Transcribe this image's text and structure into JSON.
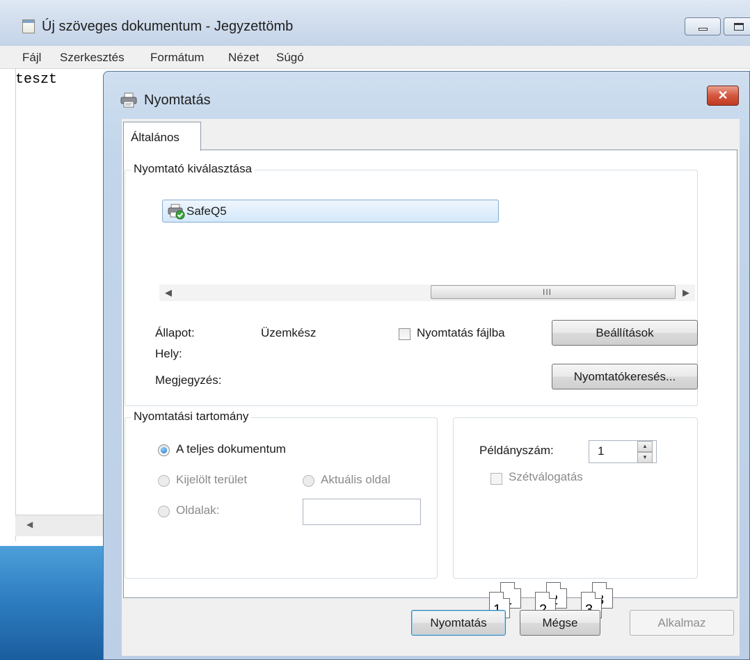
{
  "notepad": {
    "title": "Új szöveges dokumentum - Jegyzettömb",
    "menu": [
      "Fájl",
      "Szerkesztés",
      "Formátum",
      "Nézet",
      "Súgó"
    ],
    "content": "teszt"
  },
  "dialog": {
    "title": "Nyomtatás",
    "close_label": "✕",
    "tab": "Általános",
    "printer_group": {
      "label": "Nyomtató kiválasztása",
      "printers": [
        "SafeQ5"
      ],
      "scroll_thumb": "III",
      "status_label": "Állapot:",
      "status_value": "Üzemkész",
      "location_label": "Hely:",
      "comment_label": "Megjegyzés:",
      "print_to_file_label": "Nyomtatás fájlba",
      "print_to_file_checked": false,
      "preferences_button": "Beállítások",
      "find_printer_button": "Nyomtatókeresés..."
    },
    "range_group": {
      "label": "Nyomtatási tartomány",
      "all_label": "A teljes dokumentum",
      "selection_label": "Kijelölt terület",
      "current_page_label": "Aktuális oldal",
      "pages_label": "Oldalak:",
      "pages_value": "",
      "selected": "all"
    },
    "copies_group": {
      "copies_label": "Példányszám:",
      "copies_value": "1",
      "collate_label": "Szétválogatás",
      "collate_checked": false,
      "collate_pages": [
        "1",
        "1",
        "2",
        "2",
        "3",
        "3"
      ]
    },
    "buttons": {
      "print": "Nyomtatás",
      "cancel": "Mégse",
      "apply": "Alkalmaz"
    }
  },
  "colors": {
    "title_bar": "#cfdcec",
    "close_button": "#c94b32",
    "selection": "#d4e8fa",
    "desktop": "#2f7fc2"
  }
}
